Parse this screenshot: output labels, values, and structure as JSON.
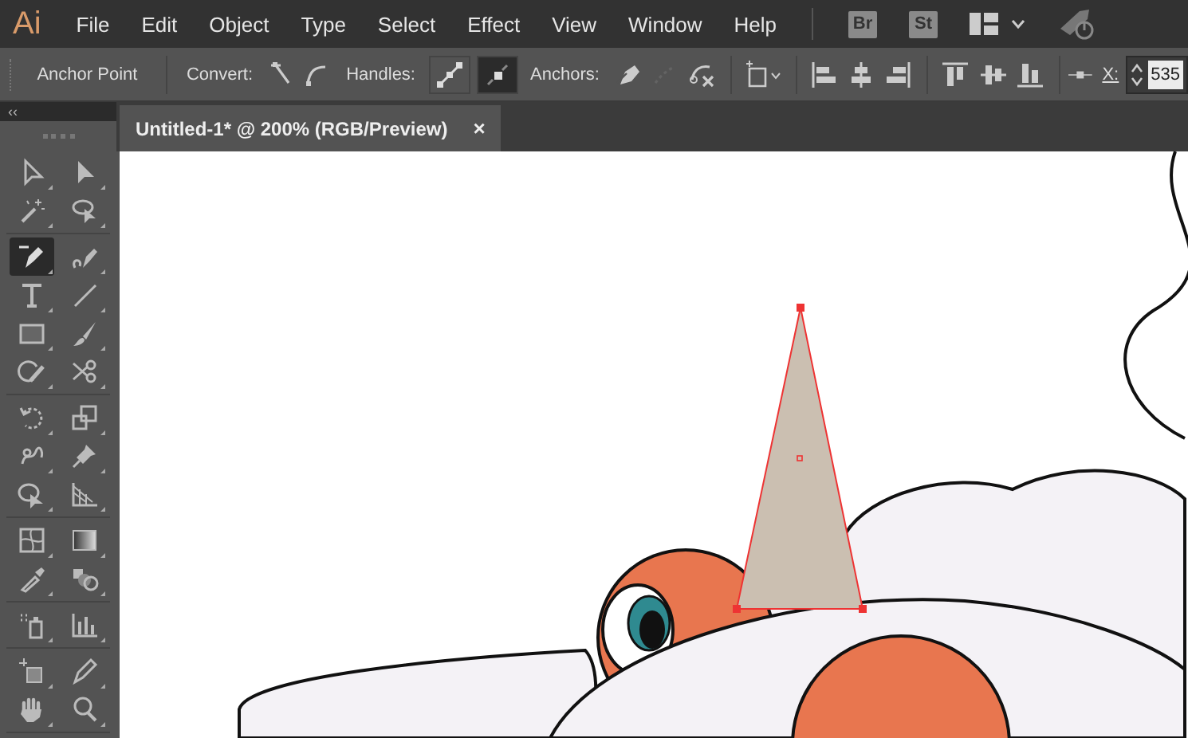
{
  "menu_bar": {
    "logo": "Ai",
    "items": [
      "File",
      "Edit",
      "Object",
      "Type",
      "Select",
      "Effect",
      "View",
      "Window",
      "Help"
    ],
    "bridge": "Br",
    "stock": "St"
  },
  "control_bar": {
    "tool_name": "Anchor Point",
    "convert": {
      "label": "Convert:"
    },
    "handles": {
      "label": "Handles:",
      "buttons": [
        {
          "kind": "show",
          "selected": false
        },
        {
          "kind": "hide",
          "selected": true
        }
      ]
    },
    "anchors": {
      "label": "Anchors:",
      "buttons": [
        {
          "kind": "remove",
          "disabled": false
        },
        {
          "kind": "connect",
          "disabled": true
        },
        {
          "kind": "cut",
          "disabled": false
        }
      ]
    },
    "x_field": {
      "label": "X:",
      "value": "535"
    }
  },
  "document_tabs": [
    {
      "title": "Untitled-1* @ 200% (RGB/Preview)",
      "close": "×",
      "selected": true
    }
  ],
  "tools": {
    "collapse": "‹‹",
    "groups": [
      [
        [
          {
            "kind": "selection",
            "selected": false
          },
          {
            "kind": "direct-selection",
            "selected": false
          }
        ],
        [
          {
            "kind": "magic-wand",
            "selected": false
          },
          {
            "kind": "lasso",
            "selected": false
          }
        ]
      ],
      [
        [
          {
            "kind": "pen",
            "selected": true
          },
          {
            "kind": "curvature",
            "selected": false
          }
        ],
        [
          {
            "kind": "type",
            "selected": false
          },
          {
            "kind": "line",
            "selected": false
          }
        ],
        [
          {
            "kind": "rectangle",
            "selected": false
          },
          {
            "kind": "paintbrush",
            "selected": false
          }
        ],
        [
          {
            "kind": "shaper",
            "selected": false
          },
          {
            "kind": "scissors",
            "selected": false
          }
        ]
      ],
      [
        [
          {
            "kind": "rotate",
            "selected": false
          },
          {
            "kind": "scale",
            "selected": false
          }
        ],
        [
          {
            "kind": "warp",
            "selected": false
          },
          {
            "kind": "pin",
            "selected": false
          }
        ],
        [
          {
            "kind": "shape-builder",
            "selected": false
          },
          {
            "kind": "perspective",
            "selected": false
          }
        ]
      ],
      [
        [
          {
            "kind": "mesh",
            "selected": false
          },
          {
            "kind": "gradient",
            "selected": false
          }
        ],
        [
          {
            "kind": "eyedropper",
            "selected": false
          },
          {
            "kind": "blend",
            "selected": false
          }
        ]
      ],
      [
        [
          {
            "kind": "symbol-sprayer",
            "selected": false
          },
          {
            "kind": "graph",
            "selected": false
          }
        ]
      ],
      [
        [
          {
            "kind": "artboard",
            "selected": false
          },
          {
            "kind": "knife",
            "selected": false
          }
        ],
        [
          {
            "kind": "hand",
            "selected": false
          },
          {
            "kind": "zoom",
            "selected": false
          }
        ]
      ]
    ]
  }
}
